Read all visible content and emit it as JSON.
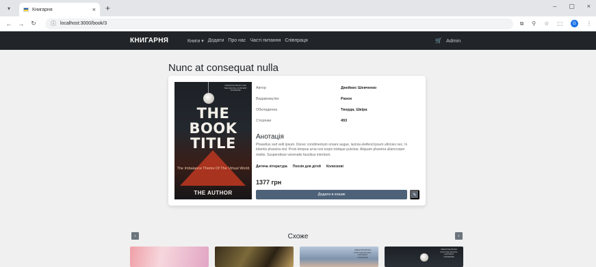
{
  "browser": {
    "tab_title": "Книгарня",
    "tab_close": "×",
    "new_tab": "+",
    "url": "localhost:3000/book/3",
    "win_min": "–",
    "win_restore": "▢",
    "win_close": "×",
    "profile_letter": "G"
  },
  "navbar": {
    "brand": "КНИГАРНЯ",
    "menu": [
      "Книги ▾",
      "Додати",
      "Про нас",
      "Часті питання",
      "Співпраця"
    ],
    "cart_icon": "🛒",
    "user": "Admin"
  },
  "book": {
    "title": "Nunc at consequat nulla",
    "cover": {
      "small_top": "CREATIVE BOOK FOR THE DIGITAL CONTENT UNIVERSE",
      "line1": "THE",
      "line2": "BOOK",
      "line3": "TITLE",
      "subtitle": "The Imbalance Theme Of The Virtual World",
      "author": "THE AUTHOR"
    },
    "specs": [
      {
        "label": "Автор",
        "value": "Джейкис Шевченко"
      },
      {
        "label": "Видавництво",
        "value": "Ранок"
      },
      {
        "label": "Обкладинка",
        "value": "Тверда, Шкіра"
      },
      {
        "label": "Сторінки",
        "value": "493"
      }
    ],
    "annotation_heading": "Анотація",
    "annotation": "Phasellus sed velit ipsum. Donec condimentum ornare augue, lacinia eleifend ipsum ultricies nec. In lobortis pharetra nisl. Proin tempus urna non turpis tristique pulvinar. Aliquam pharetra ullamcorper mattis. Suspendisse venenatis faucibus interdum.",
    "genres": [
      "Дитяча література",
      "Поезія для дітей",
      "Колискові"
    ],
    "price": "1377 грн",
    "buy_label": "Додати в кошик",
    "edit_icon": "✎"
  },
  "similar": {
    "title": "Схоже",
    "prev": "‹",
    "next": "›",
    "thumb3_text": "CREATIVE BOOK FOR THE DIGITAL CONTENT UNIVERSE",
    "thumb4_text": "CREATIVE BOOK FOR THE DIGITAL CONTENT UNIVERSE"
  }
}
